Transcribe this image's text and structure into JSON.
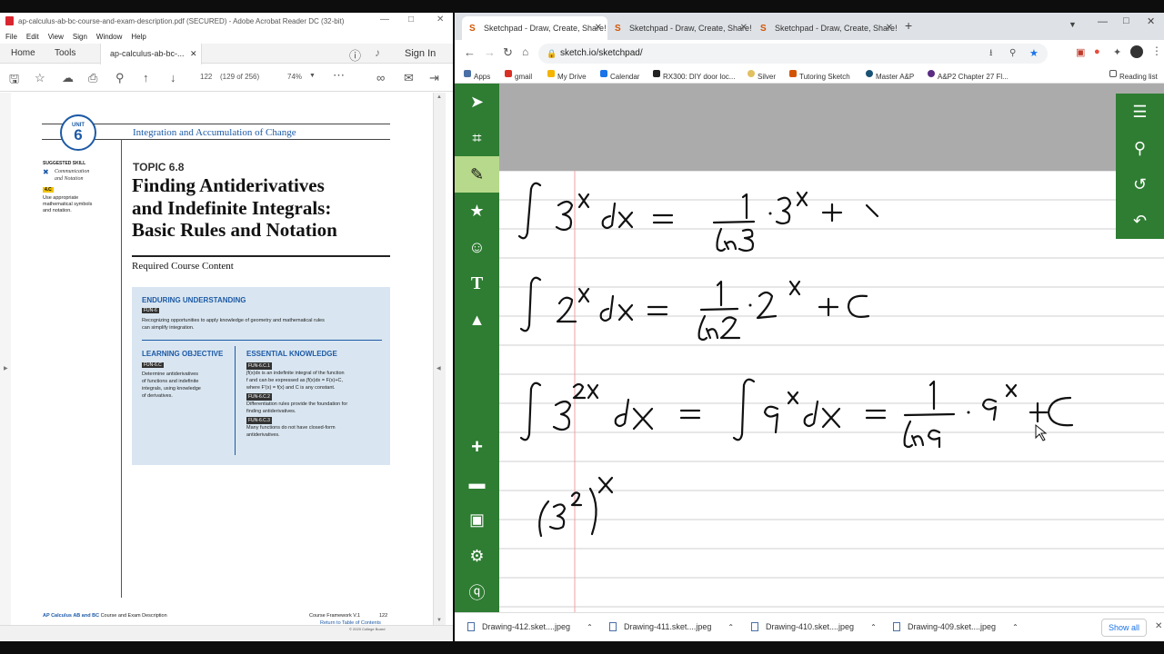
{
  "acrobat": {
    "window_title": "ap-calculus-ab-bc-course-and-exam-description.pdf (SECURED) - Adobe Acrobat Reader DC (32-bit)",
    "menu": [
      "File",
      "Edit",
      "View",
      "Sign",
      "Window",
      "Help"
    ],
    "tabs": {
      "home": "Home",
      "tools": "Tools",
      "doc": "ap-calculus-ab-bc-...",
      "sign_in": "Sign In"
    },
    "toolbar": {
      "page_current": "122",
      "page_info": "(129 of 256)",
      "zoom": "74%"
    },
    "page": {
      "unit_label": "UNIT",
      "unit_number": "6",
      "unit_title": "Integration and Accumulation of Change",
      "skill_heading": "SUGGESTED SKILL",
      "skill_name_1": "Communication",
      "skill_name_2": "and Notation",
      "skill_code": "4.C",
      "skill_desc": [
        "Use appropriate",
        "mathematical symbols",
        "and notation."
      ],
      "topic": "TOPIC 6.8",
      "heading": [
        "Finding Antiderivatives",
        "and Indefinite Integrals:",
        "Basic Rules and Notation"
      ],
      "required": "Required Course Content",
      "eu_title": "ENDURING UNDERSTANDING",
      "eu_code": "FUN-6",
      "eu_text": [
        "Recognizing opportunities to apply knowledge of geometry and mathematical rules",
        "can simplify integration."
      ],
      "lo_title": "LEARNING OBJECTIVE",
      "lo_code": "FUN-6.C",
      "lo_text": [
        "Determine antiderivatives",
        "of functions and indefinite",
        "integrals, using knowledge",
        "of derivatives."
      ],
      "ek_title": "ESSENTIAL KNOWLEDGE",
      "ek_items": [
        {
          "code": "FUN-6.C.1",
          "lines": [
            "∫f(x)dx is an indefinite integral of the function",
            "f and can be expressed as ∫f(x)dx = F(x)+C,",
            "where F′(x) = f(x) and C is any constant."
          ]
        },
        {
          "code": "FUN-6.C.2",
          "lines": [
            "Differentiation rules provide the foundation for",
            "finding antiderivatives."
          ]
        },
        {
          "code": "FUN-6.C.3",
          "lines": [
            "Many functions do not have closed-form",
            "antiderivatives."
          ]
        }
      ],
      "footer_left_bold": "AP Calculus AB and BC",
      "footer_left": "Course and Exam Description",
      "footer_right": "Course Framework V.1",
      "footer_page": "122",
      "footer_link": "Return to Table of Contents",
      "footer_copy": "© 2020 College Board"
    }
  },
  "chrome": {
    "tabs": [
      "Sketchpad - Draw, Create, Share!",
      "Sketchpad - Draw, Create, Share!",
      "Sketchpad - Draw, Create, Share!"
    ],
    "url": "sketch.io/sketchpad/",
    "bookmarks": [
      "Apps",
      "gmail",
      "My Drive",
      "Calendar",
      "RX300: DIY door loc...",
      "Silver",
      "Tutoring Sketch",
      "Master A&P",
      "A&P2 Chapter 27 Fl..."
    ],
    "reading_list": "Reading list",
    "downloads": [
      "Drawing-412.sket....jpeg",
      "Drawing-411.sket....jpeg",
      "Drawing-410.sket....jpeg",
      "Drawing-409.sket....jpeg"
    ],
    "show_all": "Show all"
  },
  "colors": {
    "sketch_green": "#2e7d32",
    "acrobat_blue": "#1d5aa6",
    "eu_box": "#d9e6f1"
  },
  "icons": {
    "left_toolbar": [
      "select-arrow-icon",
      "crop-icon",
      "pencil-icon",
      "star-icon",
      "emoji-icon",
      "text-icon",
      "paint-bucket-icon",
      "plus-icon",
      "folder-icon",
      "save-icon",
      "settings-icon",
      "help-icon"
    ],
    "right_toolbar": [
      "layers-icon",
      "zoom-icon",
      "history-icon",
      "undo-icon"
    ]
  }
}
